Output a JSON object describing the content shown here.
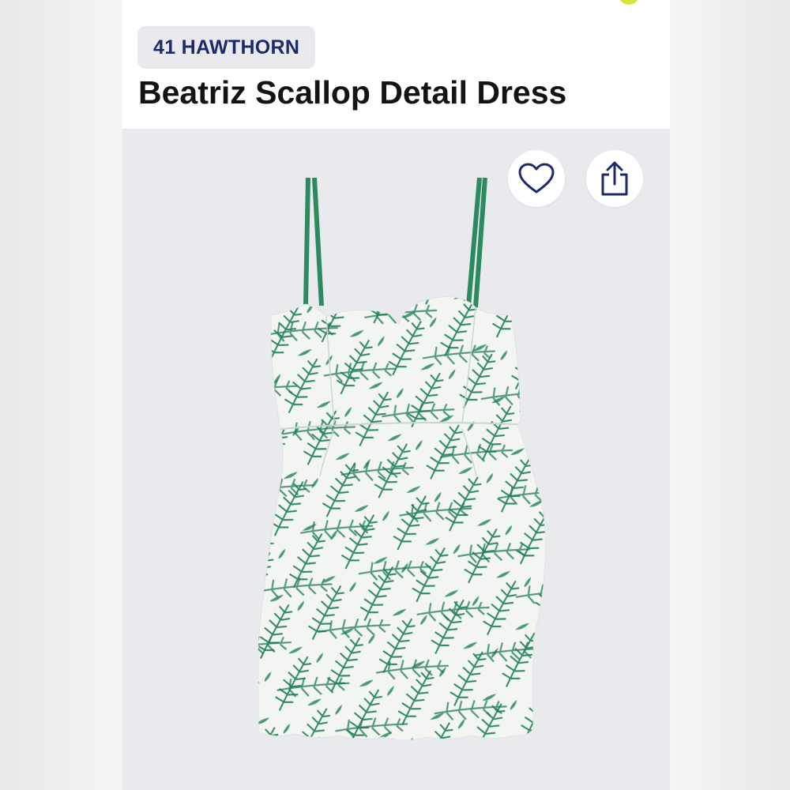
{
  "product": {
    "brand": "41 HAWTHORN",
    "name": "Beatriz Scallop Detail Dress"
  },
  "actions": {
    "favorite_icon": "heart-icon",
    "share_icon": "share-icon"
  },
  "colors": {
    "brand_text": "#1c2a6d",
    "accent_dot": "#d6e636",
    "dress_green": "#2e8a5f",
    "icon_blue": "#1c2a6d"
  }
}
